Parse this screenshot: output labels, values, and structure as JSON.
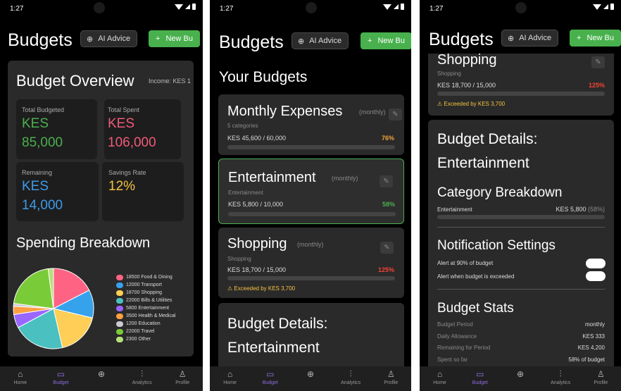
{
  "status": {
    "time": "1:27"
  },
  "header": {
    "title": "Budgets",
    "ai_label": "AI Advice",
    "new_label": "New Bu",
    "ai_icon": "brain-icon",
    "plus_icon": "plus-icon"
  },
  "nav": [
    {
      "label": "Home",
      "icon": "home-icon"
    },
    {
      "label": "Budget",
      "icon": "budget-icon"
    },
    {
      "label": "",
      "icon": "add-circle-icon"
    },
    {
      "label": "Analytics",
      "icon": "analytics-icon"
    },
    {
      "label": "Profile",
      "icon": "profile-icon"
    }
  ],
  "screen1": {
    "overview_title": "Budget Overview",
    "income_label": "Income: KES 1",
    "total_budgeted_label": "Total Budgeted",
    "total_budgeted_currency": "KES",
    "total_budgeted_value": "85,000",
    "total_spent_label": "Total Spent",
    "total_spent_currency": "KES",
    "total_spent_value": "106,000",
    "remaining_label": "Remaining",
    "remaining_currency": "KES",
    "remaining_value": "14,000",
    "savings_label": "Savings Rate",
    "savings_value": "12%",
    "spending_title": "Spending Breakdown"
  },
  "chart_data": {
    "type": "pie",
    "legend_position": "right",
    "categories": [
      "Food & Dining",
      "Transport",
      "Shopping",
      "Bills & Utilities",
      "Entertainment",
      "Health & Medical",
      "Education",
      "Travel",
      "Other"
    ],
    "values": [
      18500,
      12000,
      18700,
      22000,
      5800,
      3500,
      1200,
      22000,
      2300
    ],
    "labels": [
      "18500 Food & Dining",
      "12000 Transport",
      "18700 Shopping",
      "22000 Bills & Utilities",
      "5800 Entertainment",
      "3500 Health & Medical",
      "1200 Education",
      "22000 Travel",
      "2300 Other"
    ],
    "colors": [
      "#ff6384",
      "#36a2eb",
      "#ffce56",
      "#4bc0c0",
      "#9966ff",
      "#ff9f40",
      "#c9cbcf",
      "#7acb38",
      "#b7e07a"
    ]
  },
  "screen2": {
    "your_budgets": "Your Budgets",
    "budgets": [
      {
        "name": "Monthly Expenses",
        "period": "(monthly)",
        "category": "5 categories",
        "amount": "KES 45,600 / 60,000",
        "percent": "76%",
        "percent_color": "#f2a33a",
        "progress": 0.76
      },
      {
        "name": "Entertainment",
        "period": "(monthly)",
        "category": "Entertainment",
        "amount": "KES 5,800 / 10,000",
        "percent": "58%",
        "percent_color": "#4caf50",
        "progress": 0.58
      },
      {
        "name": "Shopping",
        "period": "(monthly)",
        "category": "Shopping",
        "amount": "KES 18,700 / 15,000",
        "percent": "125%",
        "percent_color": "#f44336",
        "progress": 1.0,
        "warning": "Exceeded by KES 3,700"
      }
    ],
    "details_title_1": "Budget Details:",
    "details_title_2": "Entertainment"
  },
  "screen3": {
    "shopping_name": "Shopping",
    "shopping_category": "Shopping",
    "shopping_amount": "KES 18,700 / 15,000",
    "shopping_percent": "125%",
    "shopping_warning": "Exceeded by KES 3,700",
    "details_title_1": "Budget Details:",
    "details_title_2": "Entertainment",
    "category_breakdown_title": "Category Breakdown",
    "breakdown_name": "Entertainment",
    "breakdown_amount": "KES 5,800",
    "breakdown_percent": "(58%)",
    "notification_title": "Notification Settings",
    "alert_90": "Alert at 90% of budget",
    "alert_exceeded": "Alert when budget is exceeded",
    "stats_title": "Budget Stats",
    "stats": [
      {
        "label": "Budget Period",
        "value": "monthly"
      },
      {
        "label": "Daily Allowance",
        "value": "KES 333"
      },
      {
        "label": "Remaining for Period",
        "value": "KES 4,200"
      },
      {
        "label": "Spent so far",
        "value": "58% of budget"
      }
    ]
  }
}
